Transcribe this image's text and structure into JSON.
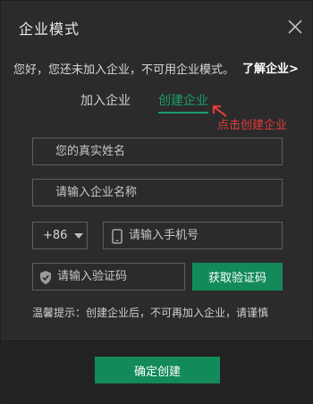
{
  "dialog": {
    "title": "企业模式",
    "notice": "您好，您还未加入企业，不可用企业模式。",
    "learn_link": "了解企业>",
    "close_icon": "close-icon"
  },
  "tabs": [
    {
      "label": "加入企业",
      "active": false
    },
    {
      "label": "创建企业",
      "active": true
    }
  ],
  "hint": {
    "text": "点击创建企业",
    "color": "#e23b3b"
  },
  "form": {
    "name_placeholder": "您的真实姓名",
    "company_placeholder": "请输入企业名称",
    "country_code": "+86",
    "phone_placeholder": "请输入手机号",
    "code_placeholder": "请输入验证码",
    "get_code_label": "获取验证码",
    "tip": "温馨提示：创建企业后，不可再加入企业，请谨慎"
  },
  "footer": {
    "confirm_label": "确定创建"
  },
  "colors": {
    "accent": "#138a5a",
    "active_tab": "#1a9f6a",
    "background": "#2b2b2b"
  }
}
